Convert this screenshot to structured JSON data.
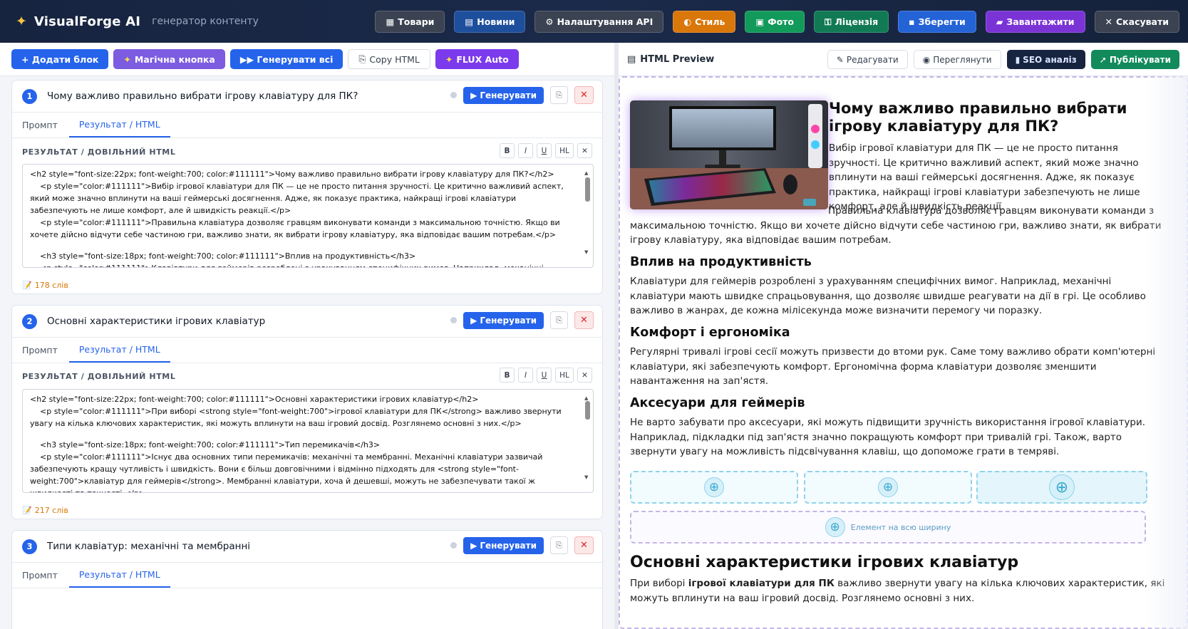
{
  "app": {
    "title": "VisualForge AI",
    "subtitle": "генератор контенту"
  },
  "top_buttons": [
    {
      "label": "Товари",
      "icon": "box-icon",
      "color": "#3b4252"
    },
    {
      "label": "Новини",
      "icon": "newspaper-icon",
      "color": "#1e4f9c"
    },
    {
      "label": "Налаштування API",
      "icon": "gear-icon",
      "color": "#3b4252"
    },
    {
      "label": "Стиль",
      "icon": "palette-icon",
      "color": "#d9770a"
    },
    {
      "label": "Фото",
      "icon": "image-icon",
      "color": "#129a5a"
    },
    {
      "label": "Ліцензія",
      "icon": "key-icon",
      "color": "#117a55"
    },
    {
      "label": "Зберегти",
      "icon": "save-icon",
      "color": "#2463d6"
    },
    {
      "label": "Завантажити",
      "icon": "folder-icon",
      "color": "#7a34d6"
    },
    {
      "label": "Скасувати",
      "icon": "close-icon",
      "color": "#3b4252"
    }
  ],
  "left_toolbar": [
    {
      "label": "+ Додати блок",
      "color": "#2563eb"
    },
    {
      "label": "Магічна кнопка",
      "icon": "sparkle-icon",
      "color": "#7c5ce0"
    },
    {
      "label": "▶▶ Генерувати всі",
      "color": "#2563eb"
    },
    {
      "label": "Copy HTML",
      "icon": "copy-icon",
      "color": "#ffffff"
    },
    {
      "label": "FLUX Auto",
      "icon": "sparkle-icon",
      "color": "#7c3aed"
    }
  ],
  "blocks": [
    {
      "num": "1",
      "title": "Чому важливо правильно вибрати ігрову клавіатуру для ПК?",
      "tabs": [
        "Промпт",
        "Результат / HTML"
      ],
      "result_label": "РЕЗУЛЬТАТ / ДОВІЛЬНИЙ HTML",
      "words": "178 слів",
      "code": [
        "<h2 style=\"font-size:22px; font-weight:700; color:#111111\">Чому важливо правильно вибрати ігрову клавіатуру для ПК?</h2>",
        "    <p style=\"color:#111111\">Вибір ігрової клавіатури для ПК — це не просто питання зручності. Це критично важливий аспект, який може значно вплинути на ваші геймерські досягнення. Адже, як показує практика, найкращі ігрові клавіатури забезпечують не лише комфорт, але й швидкість реакції.</p>",
        "    <p style=\"color:#111111\">Правильна клавіатура дозволяє гравцям виконувати команди з максимальною точністю. Якщо ви хочете дійсно відчути себе частиною гри, важливо знати, як вибрати ігрову клавіатуру, яка відповідає вашим потребам.</p>",
        "",
        "    <h3 style=\"font-size:18px; font-weight:700; color:#111111\">Вплив на продуктивність</h3>",
        "    <p style=\"color:#111111\">Клавіатури для геймерів розроблені з урахуванням специфічних вимог. Наприклад, механічні"
      ]
    },
    {
      "num": "2",
      "title": "Основні характеристики ігрових клавіатур",
      "tabs": [
        "Промпт",
        "Результат / HTML"
      ],
      "result_label": "РЕЗУЛЬТАТ / ДОВІЛЬНИЙ HTML",
      "words": "217 слів",
      "code": [
        "<h2 style=\"font-size:22px; font-weight:700; color:#111111\">Основні характеристики ігрових клавіатур</h2>",
        "    <p style=\"color:#111111\">При виборі <strong style=\"font-weight:700\">ігрової клавіатури для ПК</strong> важливо звернути увагу на кілька ключових характеристик, які можуть вплинути на ваш ігровий досвід. Розглянемо основні з них.</p>",
        "",
        "    <h3 style=\"font-size:18px; font-weight:700; color:#111111\">Тип перемикачів</h3>",
        "    <p style=\"color:#111111\">Існує два основних типи перемикачів: механічні та мембранні. Механічні клавіатури зазвичай забезпечують кращу чутливість і швидкість. Вони є більш довговічними і відмінно підходять для <strong style=\"font-weight:700\">клавіатур для геймерів</strong>. Мембранні клавіатури, хоча й дешевші, можуть не забезпечувати такої ж швидкості та точності.</p>"
      ]
    },
    {
      "num": "3",
      "title": "Типи клавіатур: механічні та мембранні",
      "tabs": [
        "Промпт",
        "Результат / HTML"
      ]
    }
  ],
  "format_buttons": [
    "B",
    "I",
    "U",
    "HL",
    "✕"
  ],
  "block_actions": {
    "generate": "Генерувати"
  },
  "preview": {
    "title": "HTML Preview",
    "buttons": [
      {
        "label": "Редагувати",
        "icon": "edit-icon"
      },
      {
        "label": "Переглянути",
        "icon": "eye-icon"
      },
      {
        "label": "SEO аналіз",
        "icon": "chart-icon",
        "color": "#172440"
      },
      {
        "label": "Публікувати",
        "icon": "rocket-icon",
        "color": "#128a5c"
      }
    ],
    "h2_1": "Чому важливо правильно вибрати ігрову клавіатуру для ПК?",
    "p1": "Вибір ігрової клавіатури для ПК — це не просто питання зручності. Це критично важливий аспект, який може значно вплинути на ваші геймерські досягнення. Адже, як показує практика, найкращі ігрові клавіатури забезпечують не лише комфорт, але й швидкість реакції.",
    "p2": "Правильна клавіатура дозволяє гравцям виконувати команди з максимальною точністю. Якщо ви хочете дійсно відчути себе частиною гри, важливо знати, як вибрати ігрову клавіатуру, яка відповідає вашим потребам.",
    "h3_1": "Вплив на продуктивність",
    "p3": "Клавіатури для геймерів розроблені з урахуванням специфічних вимог. Наприклад, механічні клавіатури мають швидке спрацьовування, що дозволяє швидше реагувати на дії в грі. Це особливо важливо в жанрах, де кожна мілісекунда може визначити перемогу чи поразку.",
    "h3_2": "Комфорт і ергономіка",
    "p4": "Регулярні тривалі ігрові сесії можуть призвести до втоми рук. Саме тому важливо обрати комп'ютерні клавіатури, які забезпечують комфорт. Ергономічна форма клавіатури дозволяє зменшити навантаження на зап'ястя.",
    "h3_3": "Аксесуари для геймерів",
    "p5": "Не варто забувати про аксесуари, які можуть підвищити зручність використання ігрової клавіатури. Наприклад, підкладки під зап'ястя значно покращують комфорт при тривалій грі. Також, варто звернути увагу на можливість підсвічування клавіш, що допоможе грати в темряві.",
    "full_width": "Елемент на всю ширину",
    "h2_2": "Основні характеристики ігрових клавіатур",
    "p6_a": "При виборі ",
    "p6_b": "ігрової клавіатури для ПК",
    "p6_c": " важливо звернути увагу на кілька ключових характеристик, які можуть вплинути на ваш ігровий досвід. Розглянемо основні з них."
  }
}
